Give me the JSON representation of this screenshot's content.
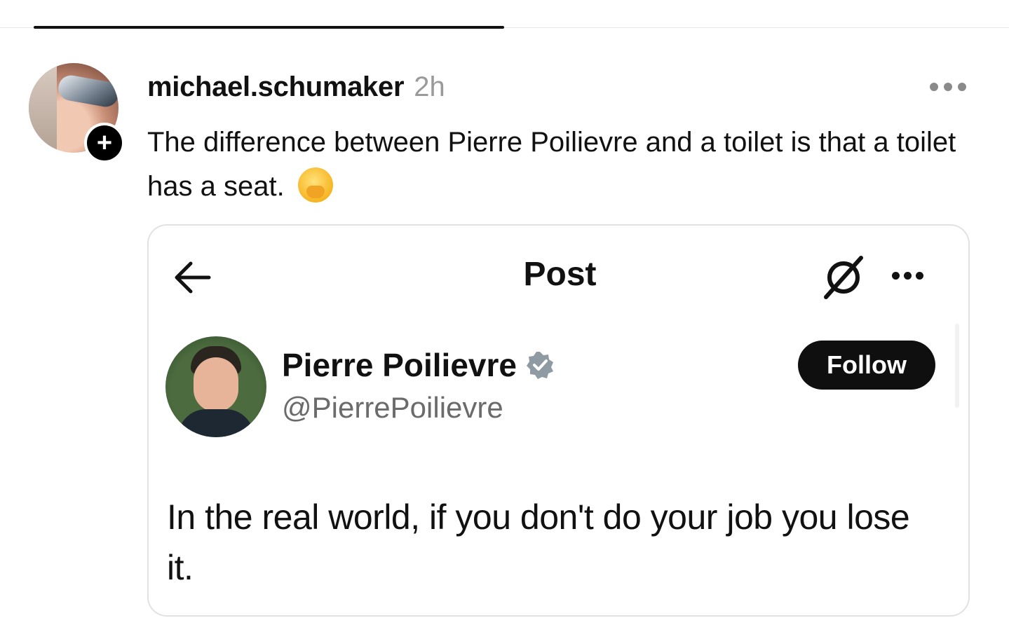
{
  "post": {
    "author": {
      "username": "michael.schumaker",
      "timestamp": "2h",
      "follow_badge": "+"
    },
    "text": "The difference between Pierre Poilievre and a toilet is that a toilet has a seat.",
    "emoji_icon": "face-with-hand-over-mouth-icon",
    "more_icon": "more-horizontal-icon"
  },
  "embed": {
    "header": {
      "title": "Post",
      "back_icon": "arrow-left-icon",
      "grok_icon": "grok-icon",
      "more_icon": "more-horizontal-icon"
    },
    "tweet": {
      "name": "Pierre Poilievre",
      "handle": "@PierrePoilievre",
      "verified_icon": "verified-badge-icon",
      "follow_label": "Follow",
      "body": "In the real world, if you don't do your job you lose it."
    }
  },
  "colors": {
    "text_primary": "#111111",
    "text_secondary": "#9a9a9a",
    "handle_gray": "#6b6b6b",
    "follow_button_bg": "#0f0f0f",
    "card_border": "#e2e2e2",
    "verified_gray": "#8f9aa3"
  }
}
